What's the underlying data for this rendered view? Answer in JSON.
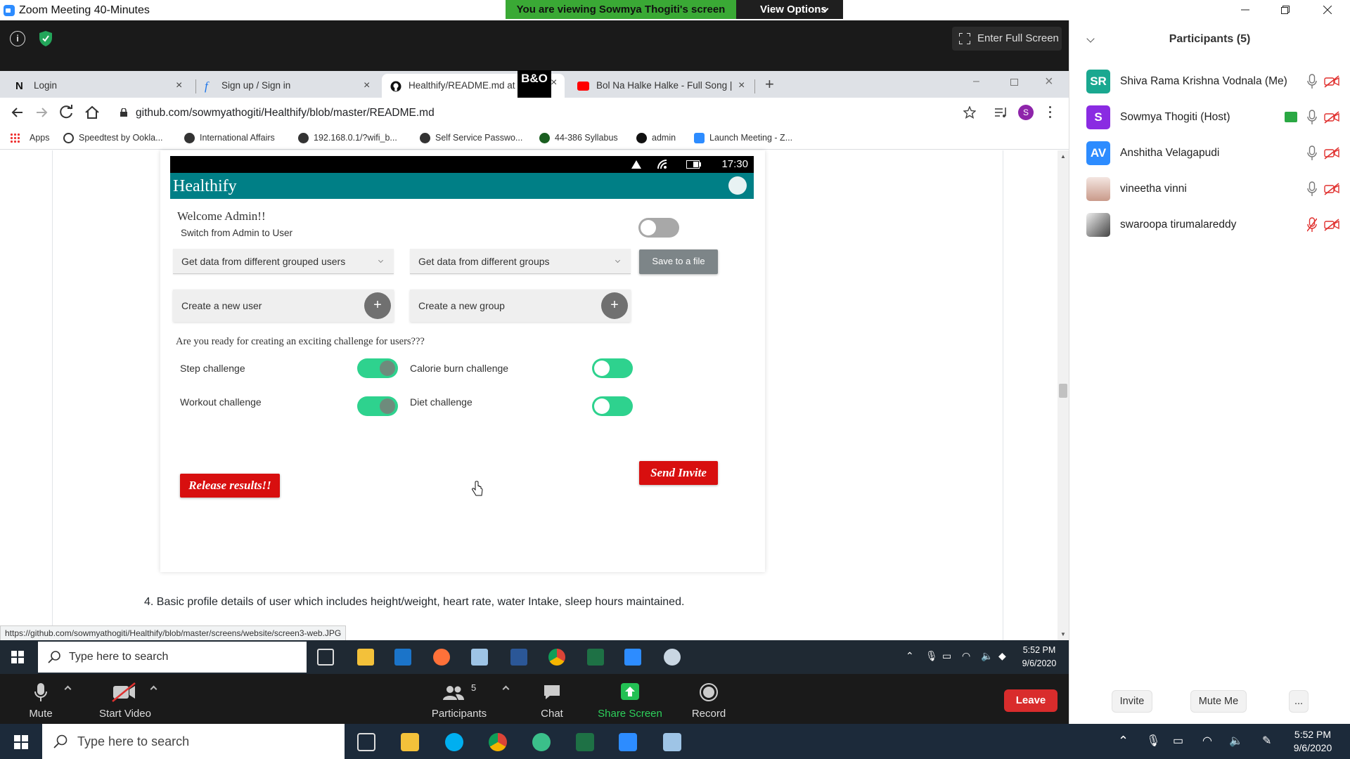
{
  "zoom": {
    "window_title": "Zoom Meeting 40-Minutes",
    "viewing_banner": "You are viewing Sowmya Thogiti's screen",
    "view_options": "View Options",
    "enter_fullscreen": "Enter Full Screen",
    "controls": {
      "mute": "Mute",
      "start_video": "Start Video",
      "participants": "Participants",
      "participants_count": "5",
      "chat": "Chat",
      "share_screen": "Share Screen",
      "record": "Record",
      "leave": "Leave"
    },
    "panel": {
      "title": "Participants (5)",
      "participants": [
        {
          "initials": "SR",
          "name": "Shiva Rama Krishna Vodnala (Me)",
          "color": "#1aa890"
        },
        {
          "initials": "S",
          "name": "Sowmya Thogiti (Host)",
          "color": "#8a2be2"
        },
        {
          "initials": "AV",
          "name": "Anshitha Velagapudi",
          "color": "#2d8cff"
        },
        {
          "initials": "",
          "name": "vineetha vinni",
          "color": "#c99a8a"
        },
        {
          "initials": "",
          "name": "swaroopa tirumalareddy",
          "color": "#555555"
        }
      ],
      "invite": "Invite",
      "mute_me": "Mute Me",
      "more": "..."
    }
  },
  "browser": {
    "tabs": [
      {
        "title": "Login",
        "icon": "notion-icon"
      },
      {
        "title": "Sign up / Sign in",
        "icon": "f-icon"
      },
      {
        "title": "Healthify/README.md at m",
        "icon": "github-icon"
      },
      {
        "title": "Bol Na Halke Halke - Full Song |",
        "icon": "youtube-icon"
      }
    ],
    "bo_label": "B&O",
    "url": "github.com/sowmyathogiti/Healthify/blob/master/README.md",
    "profile_initial": "S",
    "bookmarks": [
      "Apps",
      "Speedtest by Ookla...",
      "International Affairs",
      "192.168.0.1/?wifi_b...",
      "Self Service Passwo...",
      "44-386 Syllabus",
      "admin",
      "Launch Meeting - Z..."
    ],
    "status_url": "https://github.com/sowmyathogiti/Healthify/blob/master/screens/website/screen3-web.JPG"
  },
  "phone": {
    "time": "17:30",
    "app_title": "Healthify",
    "welcome": "Welcome Admin!!",
    "switch_label": "Switch from Admin to User",
    "dropdown_users": "Get data from different grouped users",
    "dropdown_groups": "Get data from different groups",
    "save_button": "Save to a file",
    "create_user": "Create a new user",
    "create_group": "Create a new group",
    "plus": "+",
    "challenge_prompt": "Are you ready for creating an exciting challenge for users???",
    "challenges": [
      {
        "label": "Step challenge",
        "state": "on"
      },
      {
        "label": "Calorie burn challenge",
        "state": "off"
      },
      {
        "label": "Workout challenge",
        "state": "on"
      },
      {
        "label": "Diet challenge",
        "state": "off"
      }
    ],
    "release_results": "Release results!!",
    "send_invite": "Send Invite"
  },
  "readme_item": "4. Basic profile details of user which includes height/weight, heart rate, water Intake, sleep hours maintained.",
  "taskbar_inner": {
    "search_placeholder": "Type here to search",
    "time": "5:52 PM",
    "date": "9/6/2020"
  },
  "taskbar_outer": {
    "search_placeholder": "Type here to search",
    "time": "5:52 PM",
    "date": "9/6/2020"
  }
}
